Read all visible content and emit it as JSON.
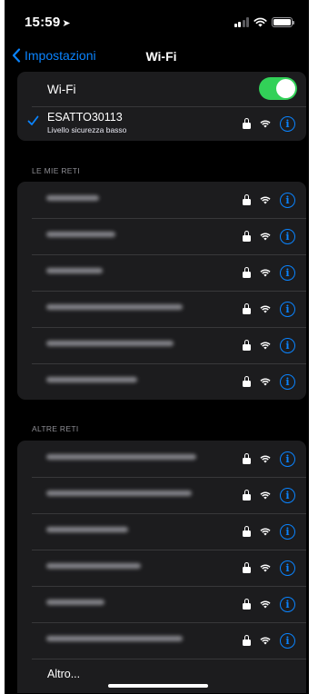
{
  "status_bar": {
    "time": "15:59",
    "location_glyph": "➤",
    "icons": [
      "signal-icon",
      "wifi-icon",
      "battery-icon"
    ]
  },
  "nav": {
    "back_label": "Impostazioni",
    "title": "Wi-Fi"
  },
  "wifi_toggle": {
    "label": "Wi-Fi",
    "on": true
  },
  "connected": {
    "name": "ESATTO30113",
    "subtitle": "Livello sicurezza basso"
  },
  "my_networks": {
    "header": "LE MIE RETI",
    "items": [
      "",
      "",
      "",
      "",
      "",
      ""
    ]
  },
  "other_networks": {
    "header": "ALTRE RETI",
    "items": [
      "",
      "",
      "",
      "",
      "",
      ""
    ],
    "other_label": "Altro..."
  },
  "colors": {
    "accent": "#0a84ff",
    "toggle_on": "#32d158",
    "cell": "#1c1c1e",
    "background": "#000000"
  }
}
